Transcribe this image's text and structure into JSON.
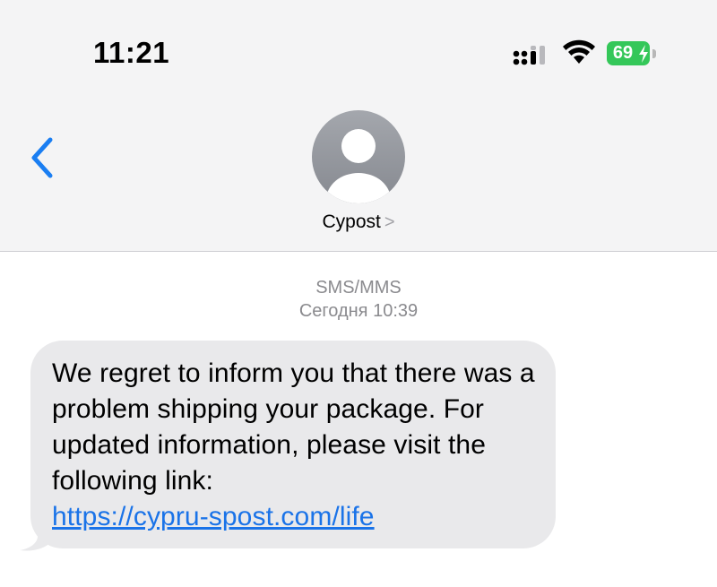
{
  "status_bar": {
    "time": "11:21",
    "battery_level": "69",
    "battery_color": "#34c759"
  },
  "nav": {
    "back_icon": "chevron-left-icon",
    "contact_name": "Cypost",
    "contact_chevron": ">",
    "accent_color": "#1a7ef2"
  },
  "conversation": {
    "service_label": "SMS/MMS",
    "timestamp": "Сегодня 10:39",
    "messages": [
      {
        "direction": "incoming",
        "text": "We regret to inform you that there was a problem shipping your package. For updated information, please visit the following link:",
        "link": "https://cypru-spost.com/life",
        "bubble_color": "#e9e9eb"
      }
    ]
  }
}
